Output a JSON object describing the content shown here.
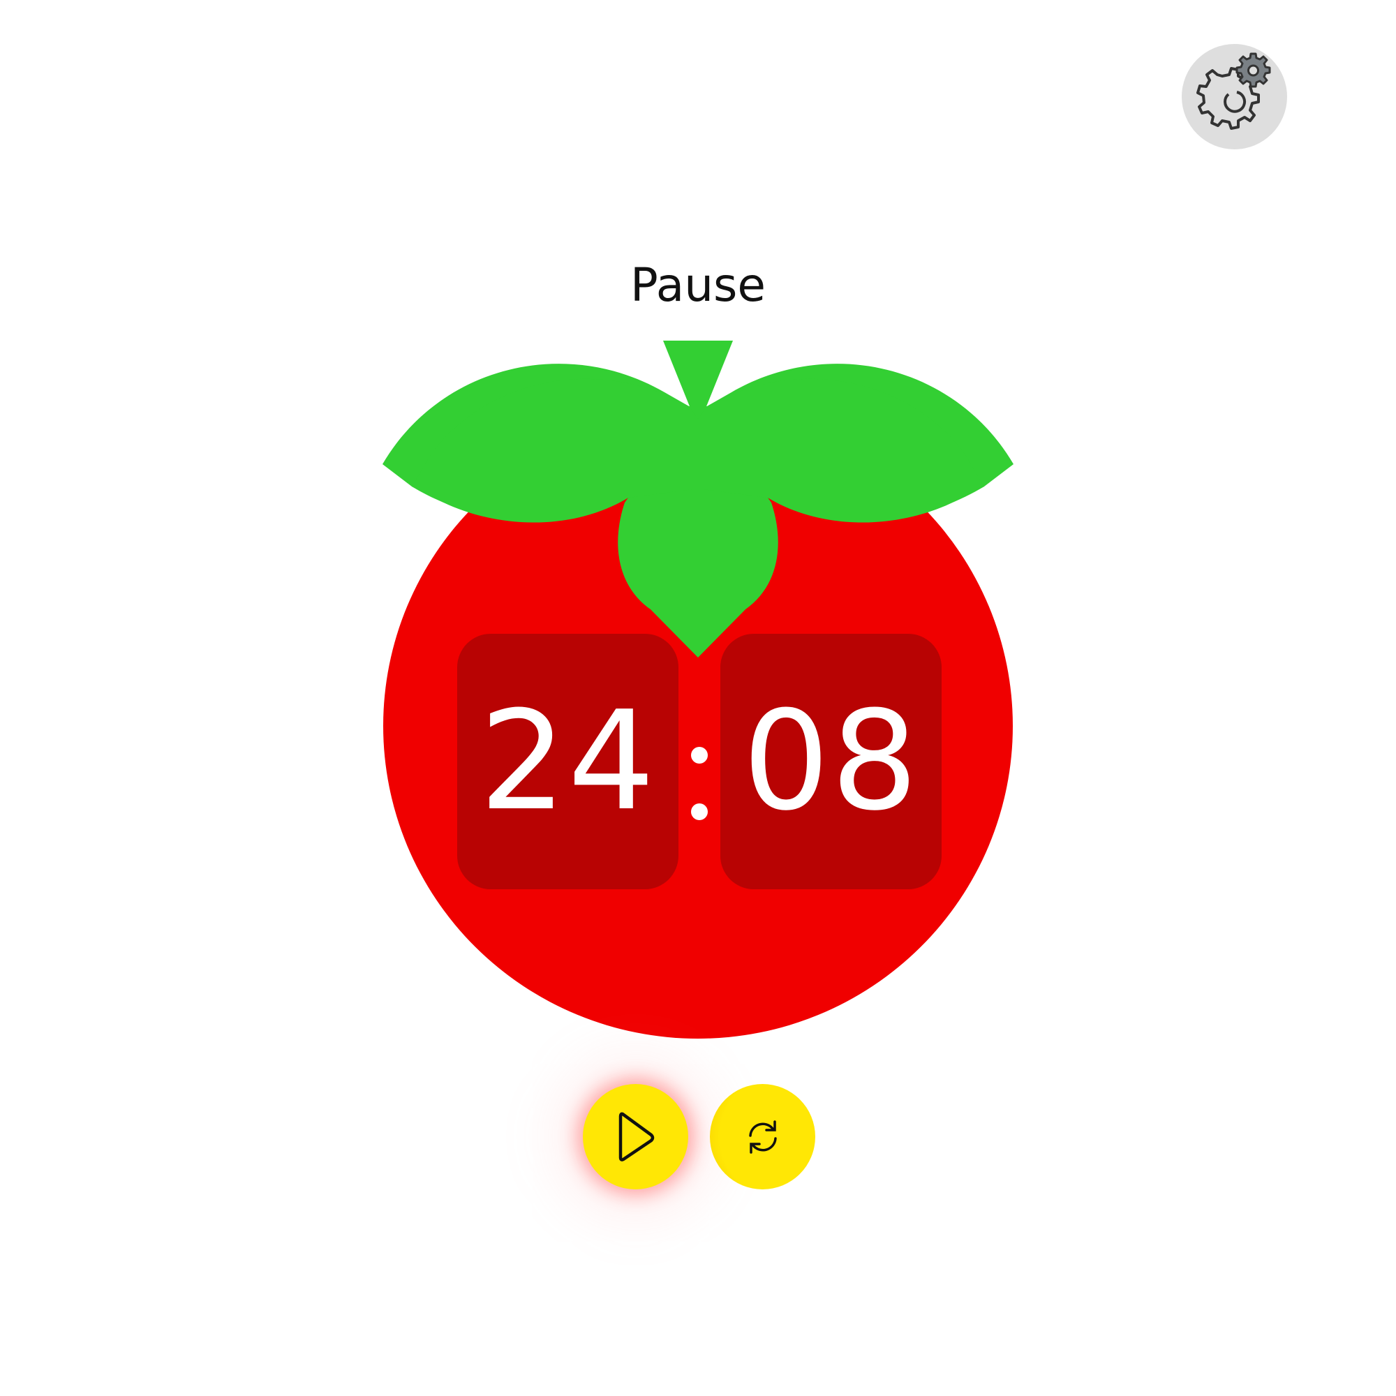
{
  "header": {
    "mode_label": "Pause"
  },
  "timer": {
    "minutes": "24",
    "seconds": "08"
  },
  "controls": {
    "play_icon": "play-icon",
    "reset_icon": "refresh-icon",
    "settings_icon": "gear-icon"
  },
  "colors": {
    "tomato": "#f00000",
    "leaves": "#33cf33",
    "time_box": "#b80303",
    "button": "#ffe705",
    "settings_bg": "#dedede"
  }
}
